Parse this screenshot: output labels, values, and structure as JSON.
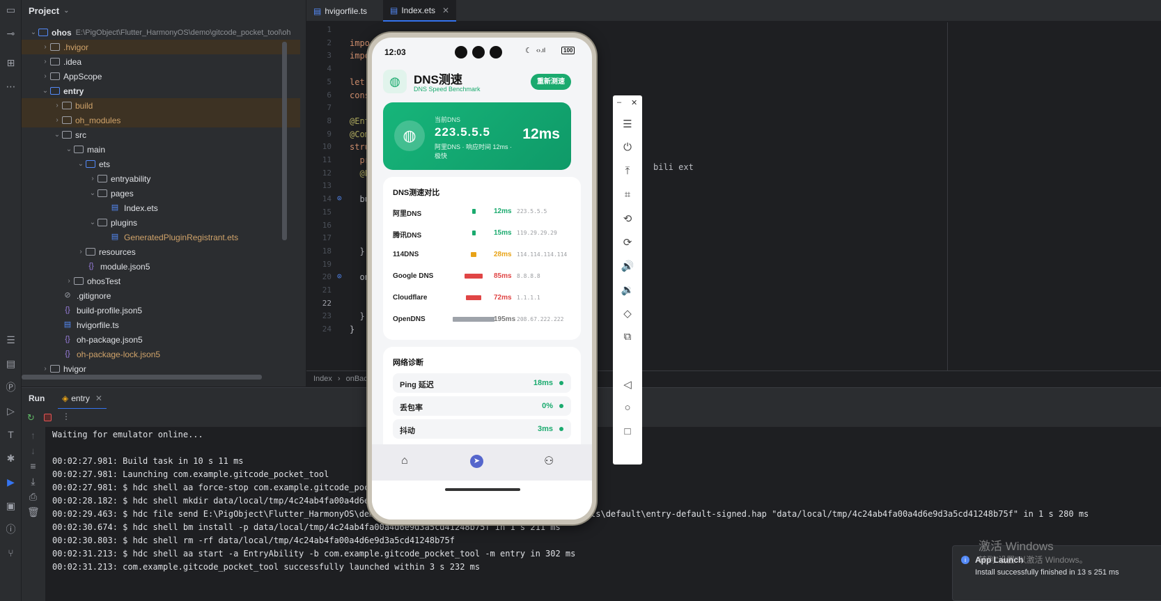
{
  "project": {
    "header": "Project",
    "tree": [
      {
        "label": "ohos",
        "extra": "E:\\PigObject\\Flutter_HarmonyOS\\demo\\gitcode_pocket_tool\\oh",
        "depth": 0,
        "open": true,
        "kind": "module",
        "bold": true
      },
      {
        "label": ".hvigor",
        "depth": 1,
        "kind": "folder",
        "hl": true,
        "color": "orange"
      },
      {
        "label": ".idea",
        "depth": 1,
        "kind": "folder"
      },
      {
        "label": "AppScope",
        "depth": 1,
        "kind": "folder"
      },
      {
        "label": "entry",
        "depth": 1,
        "open": true,
        "kind": "module",
        "bold": true
      },
      {
        "label": "build",
        "depth": 2,
        "kind": "folder",
        "hl": true,
        "color": "orange"
      },
      {
        "label": "oh_modules",
        "depth": 2,
        "kind": "folder",
        "hl": true,
        "color": "orange"
      },
      {
        "label": "src",
        "depth": 2,
        "open": true,
        "kind": "folder"
      },
      {
        "label": "main",
        "depth": 3,
        "open": true,
        "kind": "folder"
      },
      {
        "label": "ets",
        "depth": 4,
        "open": true,
        "kind": "folder-blue"
      },
      {
        "label": "entryability",
        "depth": 5,
        "kind": "folder"
      },
      {
        "label": "pages",
        "depth": 5,
        "open": true,
        "kind": "folder"
      },
      {
        "label": "Index.ets",
        "depth": 6,
        "kind": "ets",
        "leaf": true
      },
      {
        "label": "plugins",
        "depth": 5,
        "open": true,
        "kind": "folder"
      },
      {
        "label": "GeneratedPluginRegistrant.ets",
        "depth": 6,
        "kind": "ets",
        "leaf": true,
        "color": "orange"
      },
      {
        "label": "resources",
        "depth": 4,
        "kind": "folder"
      },
      {
        "label": "module.json5",
        "depth": 4,
        "kind": "json",
        "leaf": true
      },
      {
        "label": "ohosTest",
        "depth": 3,
        "kind": "folder"
      },
      {
        "label": ".gitignore",
        "depth": 2,
        "kind": "ignore",
        "leaf": true
      },
      {
        "label": "build-profile.json5",
        "depth": 2,
        "kind": "json",
        "leaf": true
      },
      {
        "label": "hvigorfile.ts",
        "depth": 2,
        "kind": "ts",
        "leaf": true
      },
      {
        "label": "oh-package.json5",
        "depth": 2,
        "kind": "json",
        "leaf": true
      },
      {
        "label": "oh-package-lock.json5",
        "depth": 2,
        "kind": "json",
        "leaf": true,
        "color": "orange"
      },
      {
        "label": "hvigor",
        "depth": 1,
        "kind": "folder"
      }
    ]
  },
  "editor": {
    "tabs": [
      {
        "label": "hvigorfile.ts",
        "active": false
      },
      {
        "label": "Index.ets",
        "active": true
      }
    ],
    "lines": [
      {
        "n": "1",
        "code": ""
      },
      {
        "n": "2",
        "code": "impor",
        "cls": "kw"
      },
      {
        "n": "3",
        "code": "impo",
        "cls": "kw"
      },
      {
        "n": "4",
        "code": ""
      },
      {
        "n": "5",
        "code": "let",
        "cls": "kw"
      },
      {
        "n": "6",
        "code": "cons",
        "cls": "kw"
      },
      {
        "n": "7",
        "code": ""
      },
      {
        "n": "8",
        "code": "@Ent",
        "cls": "an"
      },
      {
        "n": "9",
        "code": "@Com",
        "cls": "an"
      },
      {
        "n": "10",
        "code": "stru",
        "cls": "kw"
      },
      {
        "n": "11",
        "code": "  pr",
        "cls": "kw"
      },
      {
        "n": "12",
        "code": "  @L",
        "cls": "an"
      },
      {
        "n": "13",
        "code": ""
      },
      {
        "n": "14",
        "code": "  bu"
      },
      {
        "n": "15",
        "code": ""
      },
      {
        "n": "16",
        "code": ""
      },
      {
        "n": "17",
        "code": ""
      },
      {
        "n": "18",
        "code": "  }"
      },
      {
        "n": "19",
        "code": ""
      },
      {
        "n": "20",
        "code": "  on"
      },
      {
        "n": "21",
        "code": ""
      },
      {
        "n": "22",
        "code": ""
      },
      {
        "n": "23",
        "code": "  }"
      },
      {
        "n": "24",
        "code": "}"
      }
    ],
    "fragment": "bili    ext",
    "breadcrumb": [
      "Index",
      "onBac"
    ]
  },
  "run": {
    "title": "Run",
    "tab": "entry",
    "console": [
      "Waiting for emulator online...",
      "",
      "00:02:27.981: Build task in 10 s 11 ms",
      "00:02:27.981: Launching com.example.gitcode_pocket_tool",
      "00:02:27.981: $ hdc shell aa force-stop com.example.gitcode_pock",
      "00:02:28.182: $ hdc shell mkdir data/local/tmp/4c24ab4fa00a4d6e9",
      "00:02:29.463: $ hdc file send E:\\PigObject\\Flutter_HarmonyOS\\demo                                   t\\outputs\\default\\entry-default-signed.hap \"data/local/tmp/4c24ab4fa00a4d6e9d3a5cd41248b75f\" in 1 s 280 ms",
      "00:02:30.674: $ hdc shell bm install -p data/local/tmp/4c24ab4fa00a4d6e9d3a5cd41248b75f in 1 s 211 ms",
      "00:02:30.803: $ hdc shell rm -rf data/local/tmp/4c24ab4fa00a4d6e9d3a5cd41248b75f",
      "00:02:31.213: $ hdc shell aa start -a EntryAbility -b com.example.gitcode_pocket_tool -m entry in 302 ms",
      "00:02:31.213: com.example.gitcode_pocket_tool successfully launched within 3 s 232 ms"
    ]
  },
  "phone": {
    "time": "12:03",
    "battery": "100",
    "app": {
      "title": "DNS测速",
      "subtitle": "DNS Speed Benchmark",
      "retest": "重新测速",
      "current_label": "当前DNS",
      "current_ip": "223.5.5.5",
      "current_desc": "阿里DNS · 响应时间 12ms · 极快",
      "current_ms": "12ms",
      "compare_title": "DNS测速对比",
      "dns": [
        {
          "name": "阿里DNS",
          "ms": "12ms",
          "ip": "223.5.5.5",
          "value": 12,
          "color": "#1aaa6e"
        },
        {
          "name": "腾讯DNS",
          "ms": "15ms",
          "ip": "119.29.29.29",
          "value": 15,
          "color": "#1aaa6e"
        },
        {
          "name": "114DNS",
          "ms": "28ms",
          "ip": "114.114.114.114",
          "value": 28,
          "color": "#e8a317"
        },
        {
          "name": "Google DNS",
          "ms": "85ms",
          "ip": "8.8.8.8",
          "value": 85,
          "color": "#e04545"
        },
        {
          "name": "Cloudflare",
          "ms": "72ms",
          "ip": "1.1.1.1",
          "value": 72,
          "color": "#e04545"
        },
        {
          "name": "OpenDNS",
          "ms": "195ms",
          "ip": "208.67.222.222",
          "value": 195,
          "color": "#9ea3aa"
        }
      ],
      "diag_title": "网络诊断",
      "diag": [
        {
          "label": "Ping 延迟",
          "value": "18ms"
        },
        {
          "label": "丢包率",
          "value": "0%"
        },
        {
          "label": "抖动",
          "value": "3ms"
        }
      ]
    }
  },
  "toast": {
    "title": "App Launch",
    "body": "Install successfully finished in 13 s 251 ms",
    "watermark1": "激活 Windows",
    "watermark2": "转到\"设置\"以激活 Windows。"
  }
}
